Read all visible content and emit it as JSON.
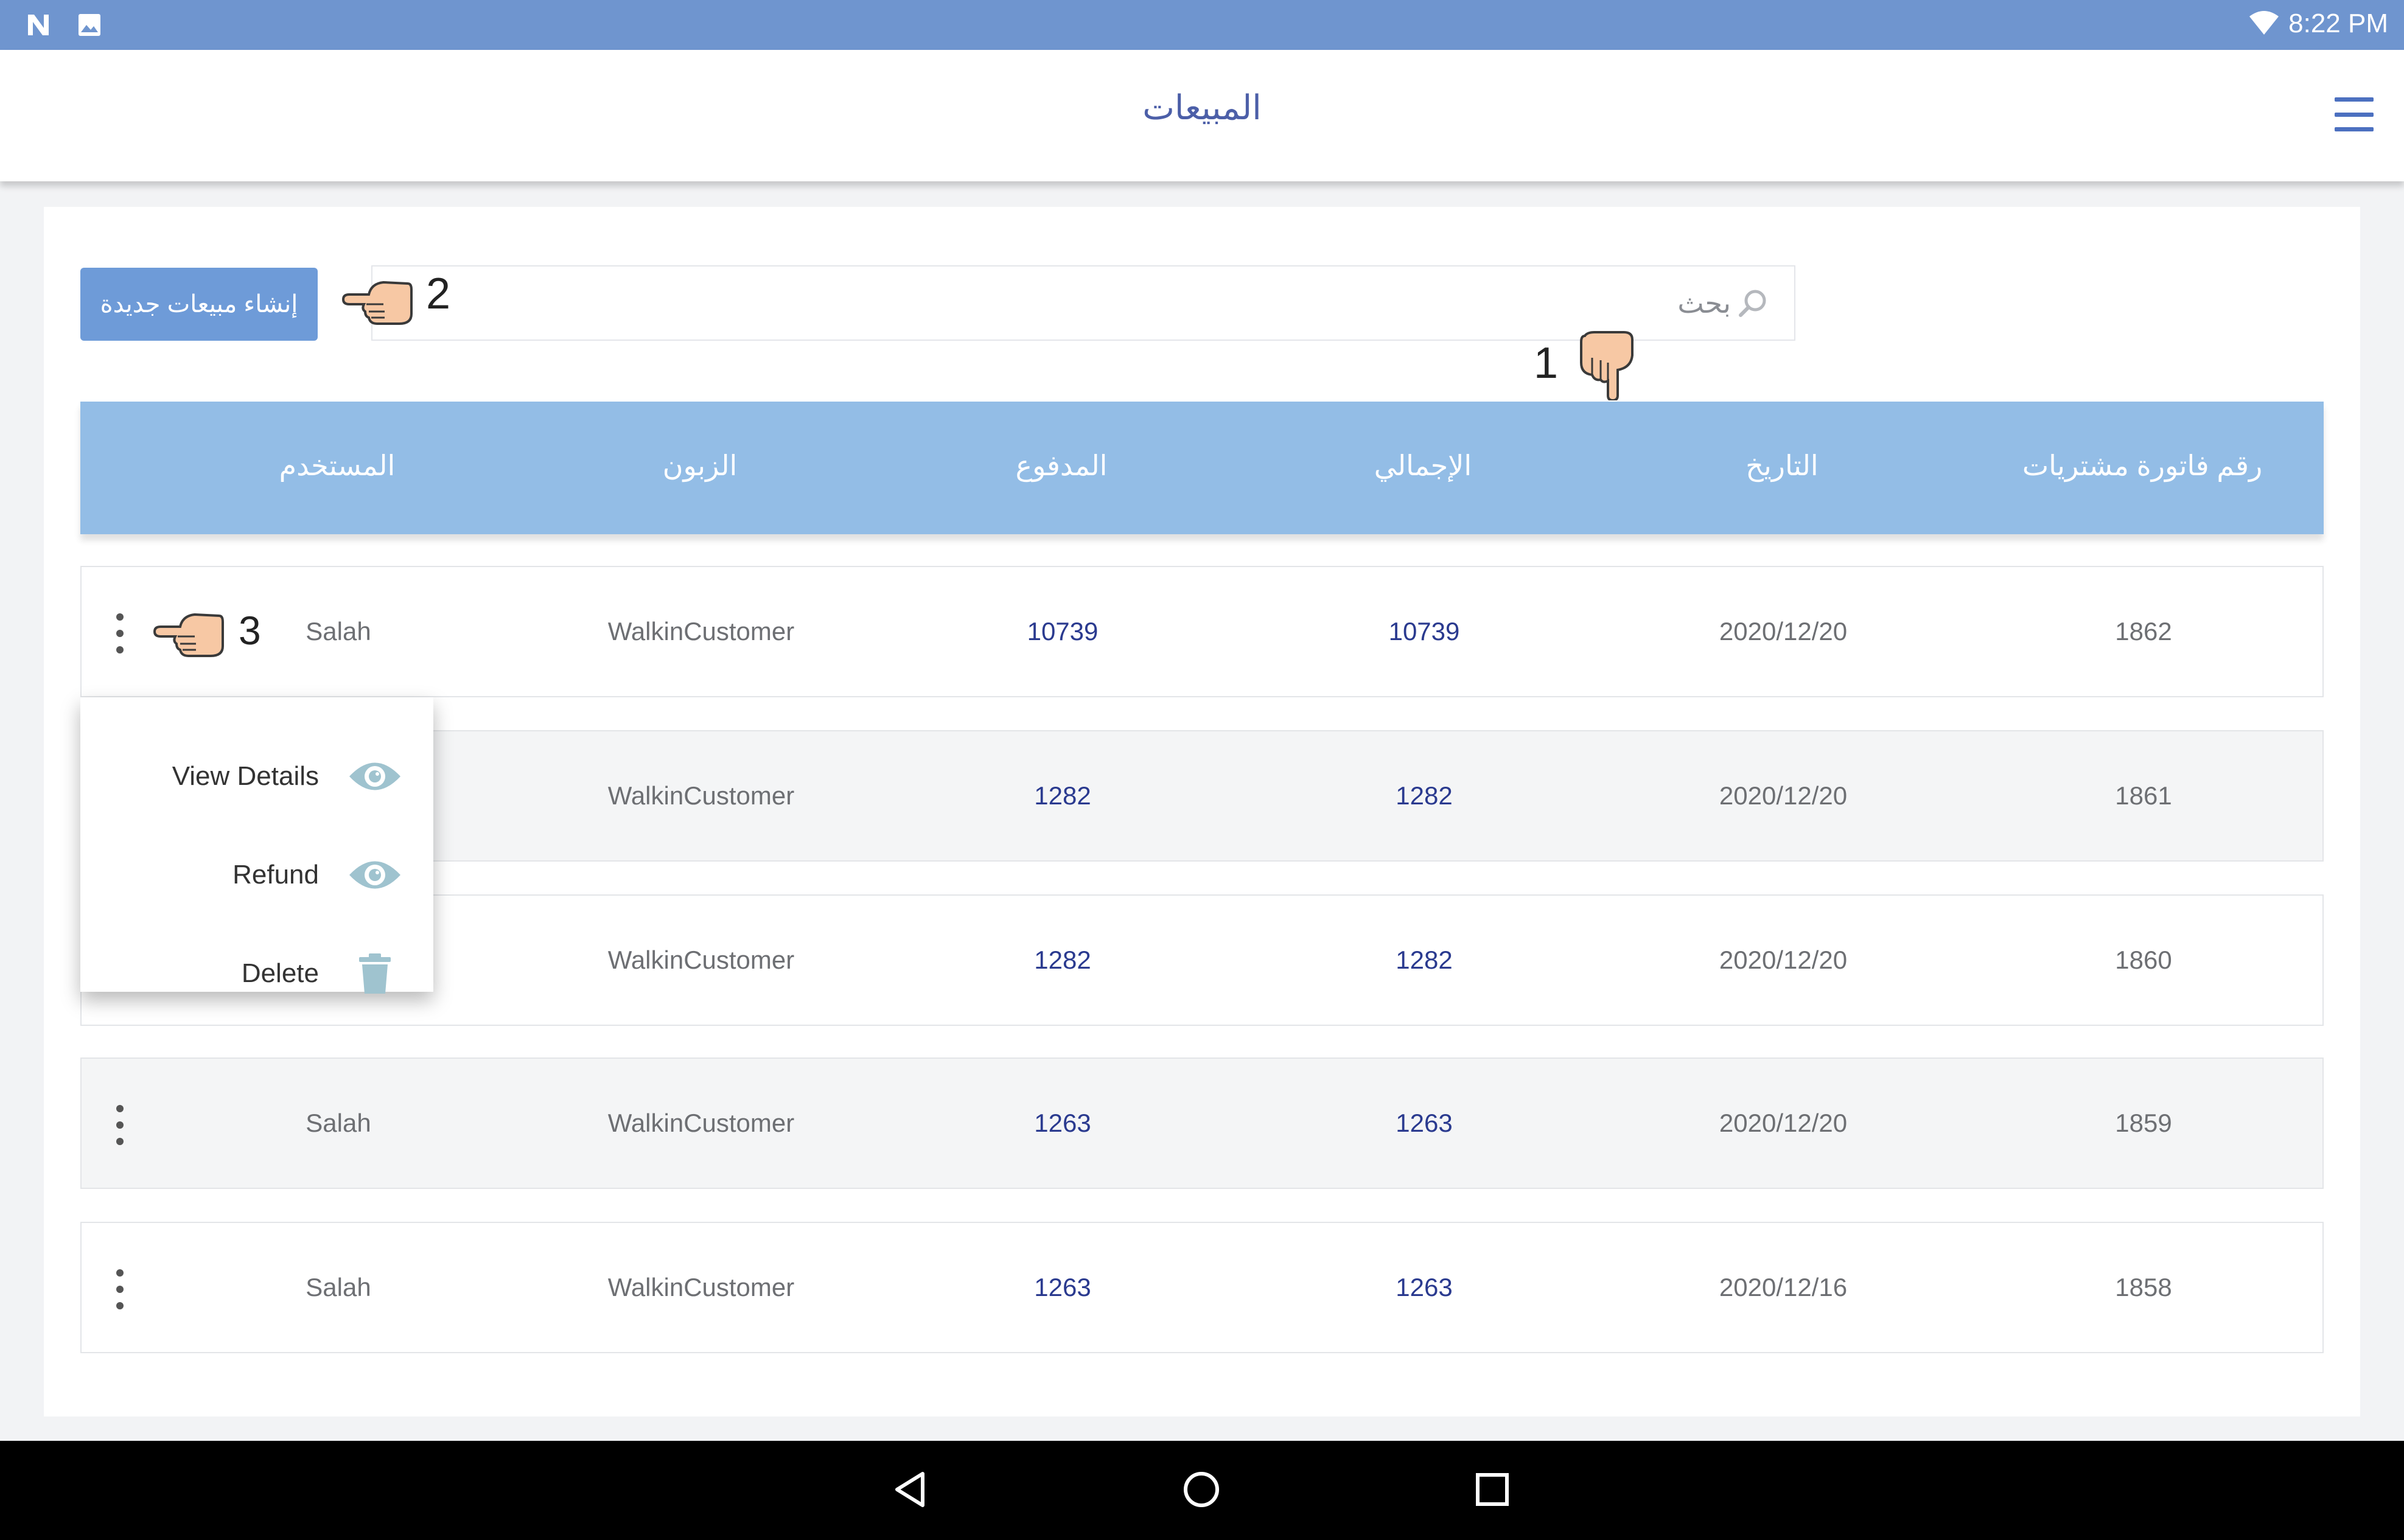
{
  "status_bar": {
    "time": "8:22 PM",
    "icons": [
      "n-notification-icon",
      "image-notification-icon",
      "wifi-icon"
    ]
  },
  "app_bar": {
    "title": "المبيعات",
    "menu_icon": "hamburger-menu-icon"
  },
  "toolbar": {
    "new_sale_label": "إنشاء مبيعات جديدة",
    "search_placeholder": "بحث",
    "annotations": [
      "1",
      "2"
    ]
  },
  "table": {
    "columns": [
      "رقم فاتورة مشتريات",
      "التاريخ",
      "الإجمالي",
      "المدفوع",
      "الزبون",
      "المستخدم"
    ],
    "rows": [
      {
        "invoice": "1862",
        "date": "2020/12/20",
        "total": "10739",
        "paid": "10739",
        "customer": "WalkinCustomer",
        "user": "Salah"
      },
      {
        "invoice": "1861",
        "date": "2020/12/20",
        "total": "1282",
        "paid": "1282",
        "customer": "WalkinCustomer",
        "user": ""
      },
      {
        "invoice": "1860",
        "date": "2020/12/20",
        "total": "1282",
        "paid": "1282",
        "customer": "WalkinCustomer",
        "user": ""
      },
      {
        "invoice": "1859",
        "date": "2020/12/20",
        "total": "1263",
        "paid": "1263",
        "customer": "WalkinCustomer",
        "user": "Salah"
      },
      {
        "invoice": "1858",
        "date": "2020/12/16",
        "total": "1263",
        "paid": "1263",
        "customer": "WalkinCustomer",
        "user": "Salah"
      }
    ],
    "row_annotation": "3"
  },
  "popup_menu": {
    "items": [
      {
        "label": "View Details",
        "icon": "eye-icon"
      },
      {
        "label": "Refund",
        "icon": "eye-icon"
      },
      {
        "label": "Delete",
        "icon": "trash-icon"
      }
    ]
  },
  "nav_bar": {
    "icons": [
      "back-icon",
      "home-icon",
      "recents-icon"
    ]
  },
  "colors": {
    "status_bar": "#6f95cf",
    "header": "#93bde6",
    "button": "#6e9bd8",
    "value_blue": "#2a3a8f"
  }
}
